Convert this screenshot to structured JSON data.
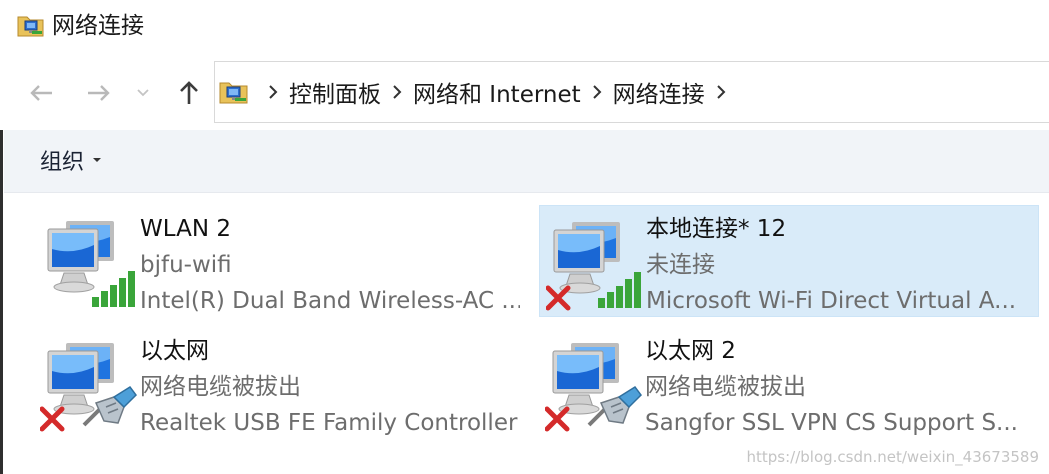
{
  "window": {
    "title": "网络连接"
  },
  "nav": {
    "back_label": "←",
    "forward_label": "→",
    "history_label": "⌄",
    "up_label": "↑"
  },
  "breadcrumb": [
    {
      "label": "控制面板"
    },
    {
      "label": "网络和 Internet"
    },
    {
      "label": "网络连接"
    }
  ],
  "toolbar": {
    "organize_label": "组织"
  },
  "connections": [
    {
      "name": "WLAN 2",
      "status": "bjfu-wifi",
      "device": "Intel(R) Dual Band Wireless-AC ...",
      "type": "wifi",
      "disconnected": false,
      "selected": false
    },
    {
      "name": "本地连接* 12",
      "status": "未连接",
      "device": "Microsoft Wi-Fi Direct Virtual A...",
      "type": "wifi",
      "disconnected": true,
      "selected": true
    },
    {
      "name": "以太网",
      "status": "网络电缆被拔出",
      "device": "Realtek USB FE Family Controller",
      "type": "ethernet",
      "disconnected": true,
      "selected": false
    },
    {
      "name": "以太网 2",
      "status": "网络电缆被拔出",
      "device": "Sangfor SSL VPN CS Support S...",
      "type": "ethernet",
      "disconnected": true,
      "selected": false
    }
  ],
  "watermark": "https://blog.csdn.net/weixin_43673589",
  "colors": {
    "selection_bg": "#d9ebf9",
    "command_bar_bg": "#f1f4f8",
    "signal_green": "#3aa53a",
    "error_red": "#d42a2a"
  }
}
